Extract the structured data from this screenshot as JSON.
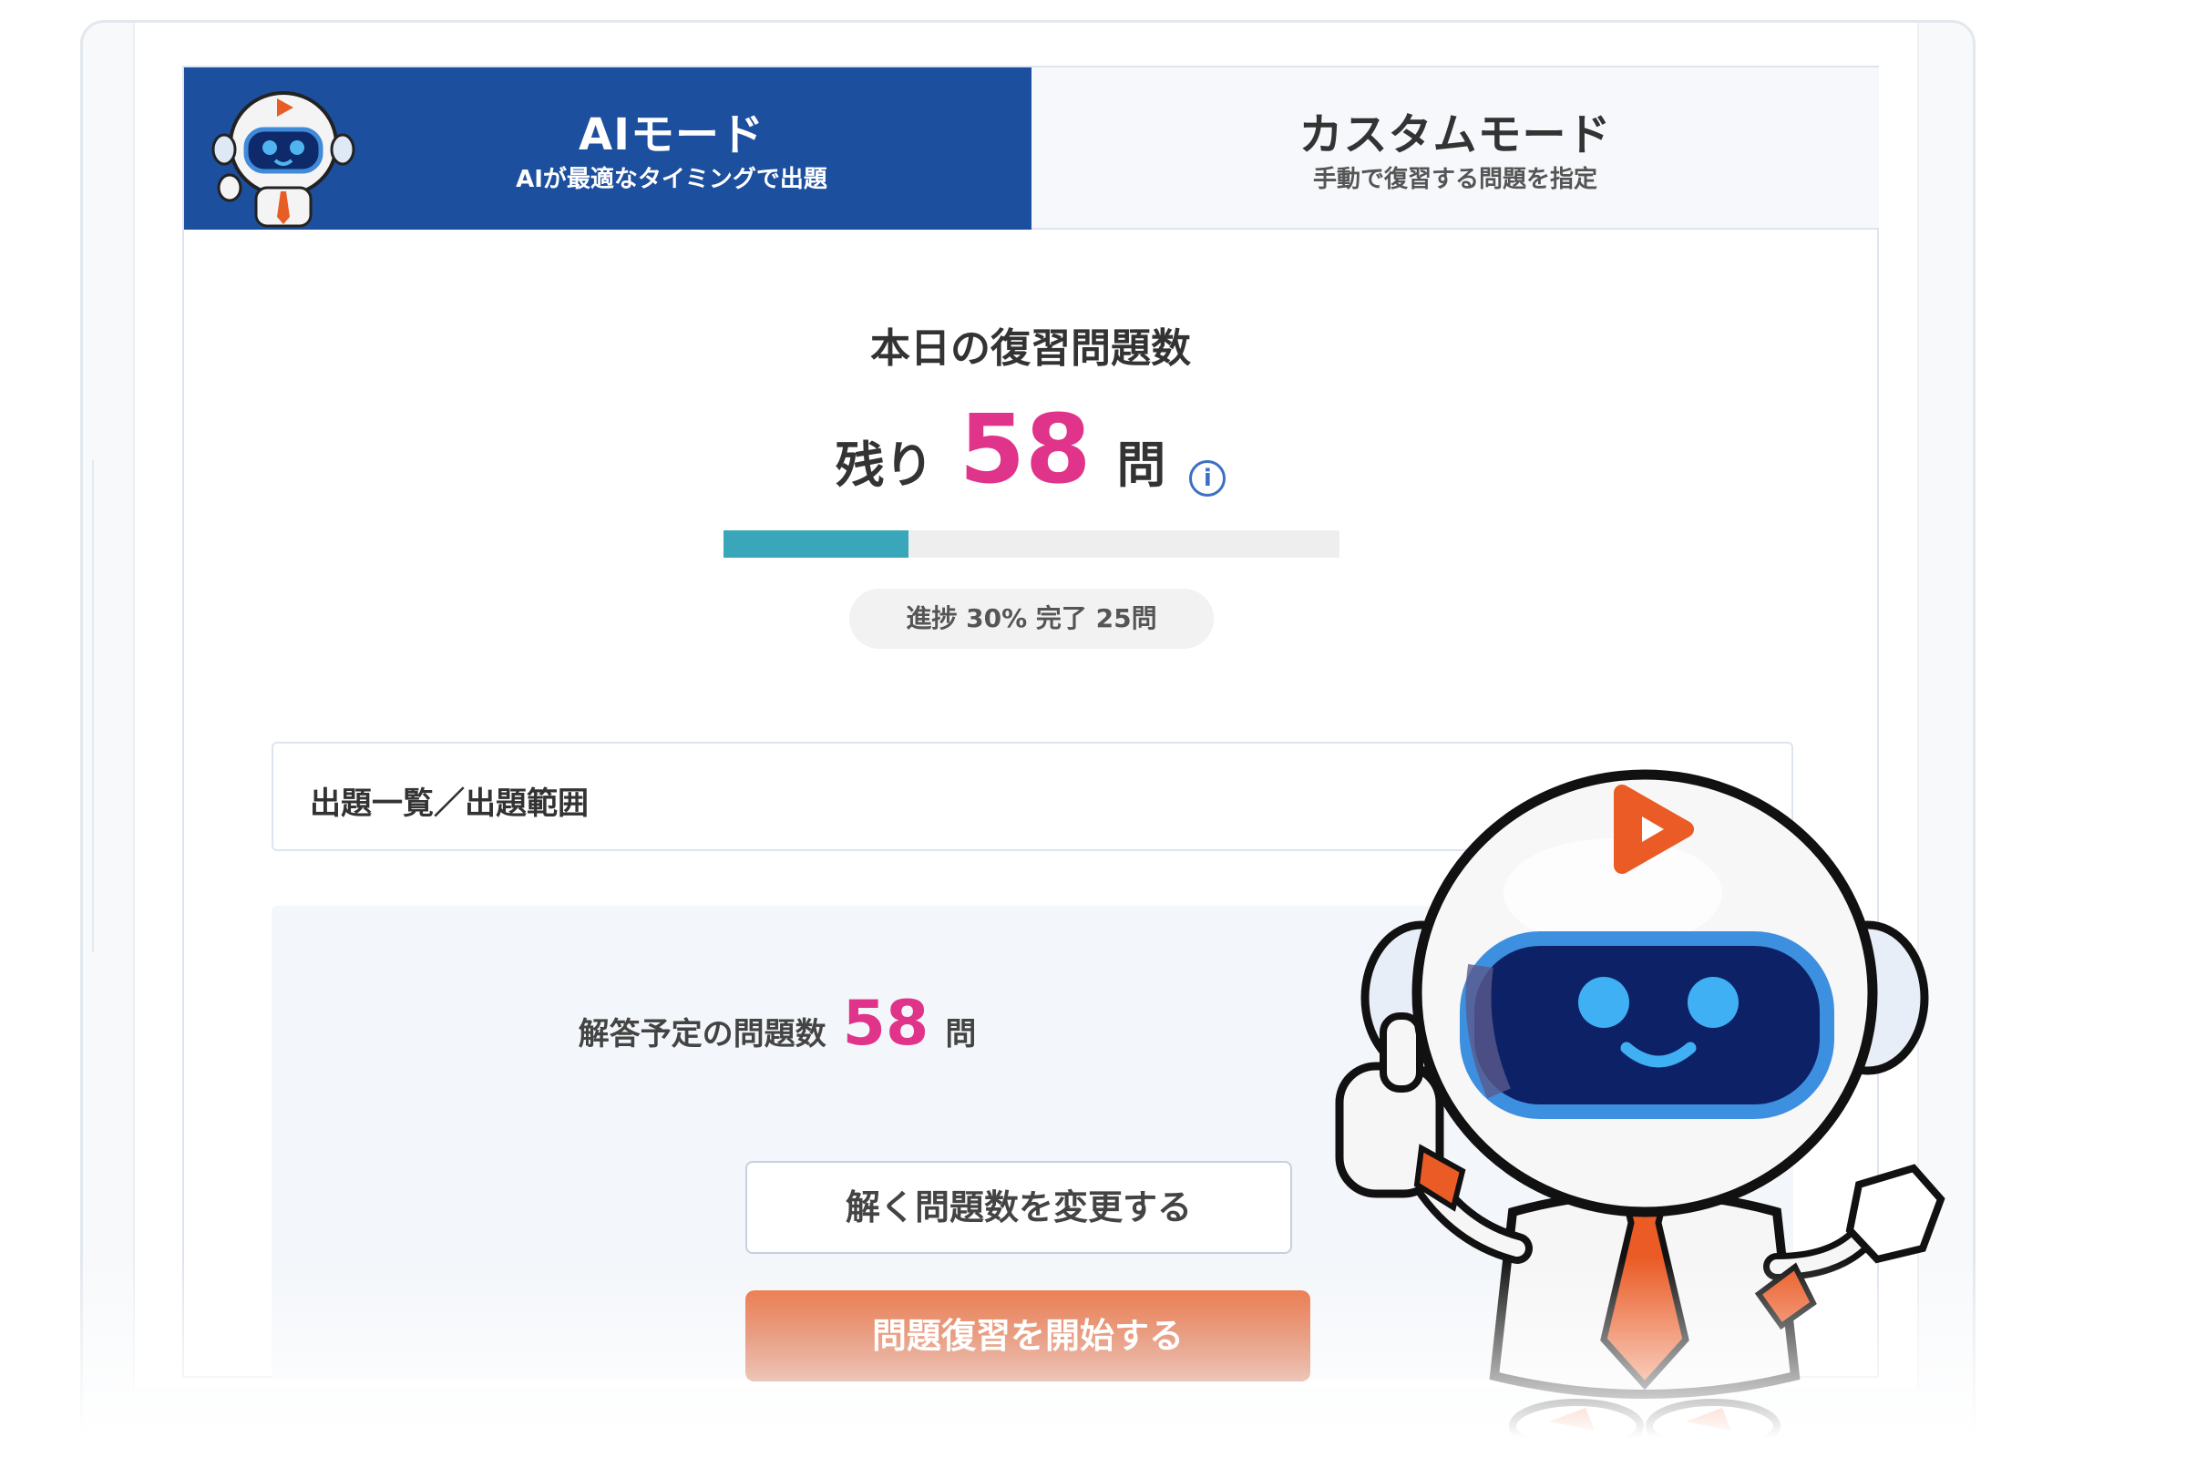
{
  "tabs": {
    "ai": {
      "title": "AIモード",
      "subtitle": "AIが最適なタイミングで出題"
    },
    "custom": {
      "title": "カスタムモード",
      "subtitle": "手動で復習する問題を指定"
    }
  },
  "today": {
    "heading": "本日の復習問題数",
    "remaining_prefix": "残り",
    "remaining_count": "58",
    "remaining_unit": "問",
    "info_icon_glyph": "i",
    "progress_fraction": 0.3,
    "progress_text": "進捗 30%  完了 25問"
  },
  "range": {
    "label": "出題一覧／出題範囲"
  },
  "planned": {
    "label": "解答予定の問題数",
    "count": "58",
    "unit": "問"
  },
  "buttons": {
    "change": "解く問題数を変更する",
    "start": "問題復習を開始する"
  },
  "colors": {
    "brand_blue": "#1d4f9f",
    "accent_pink": "#e0338a",
    "progress_teal": "#3aa6b9",
    "start_orange": "#d9541f"
  },
  "icons": {
    "mascot": "robot-mascot-icon",
    "info": "info-icon"
  }
}
